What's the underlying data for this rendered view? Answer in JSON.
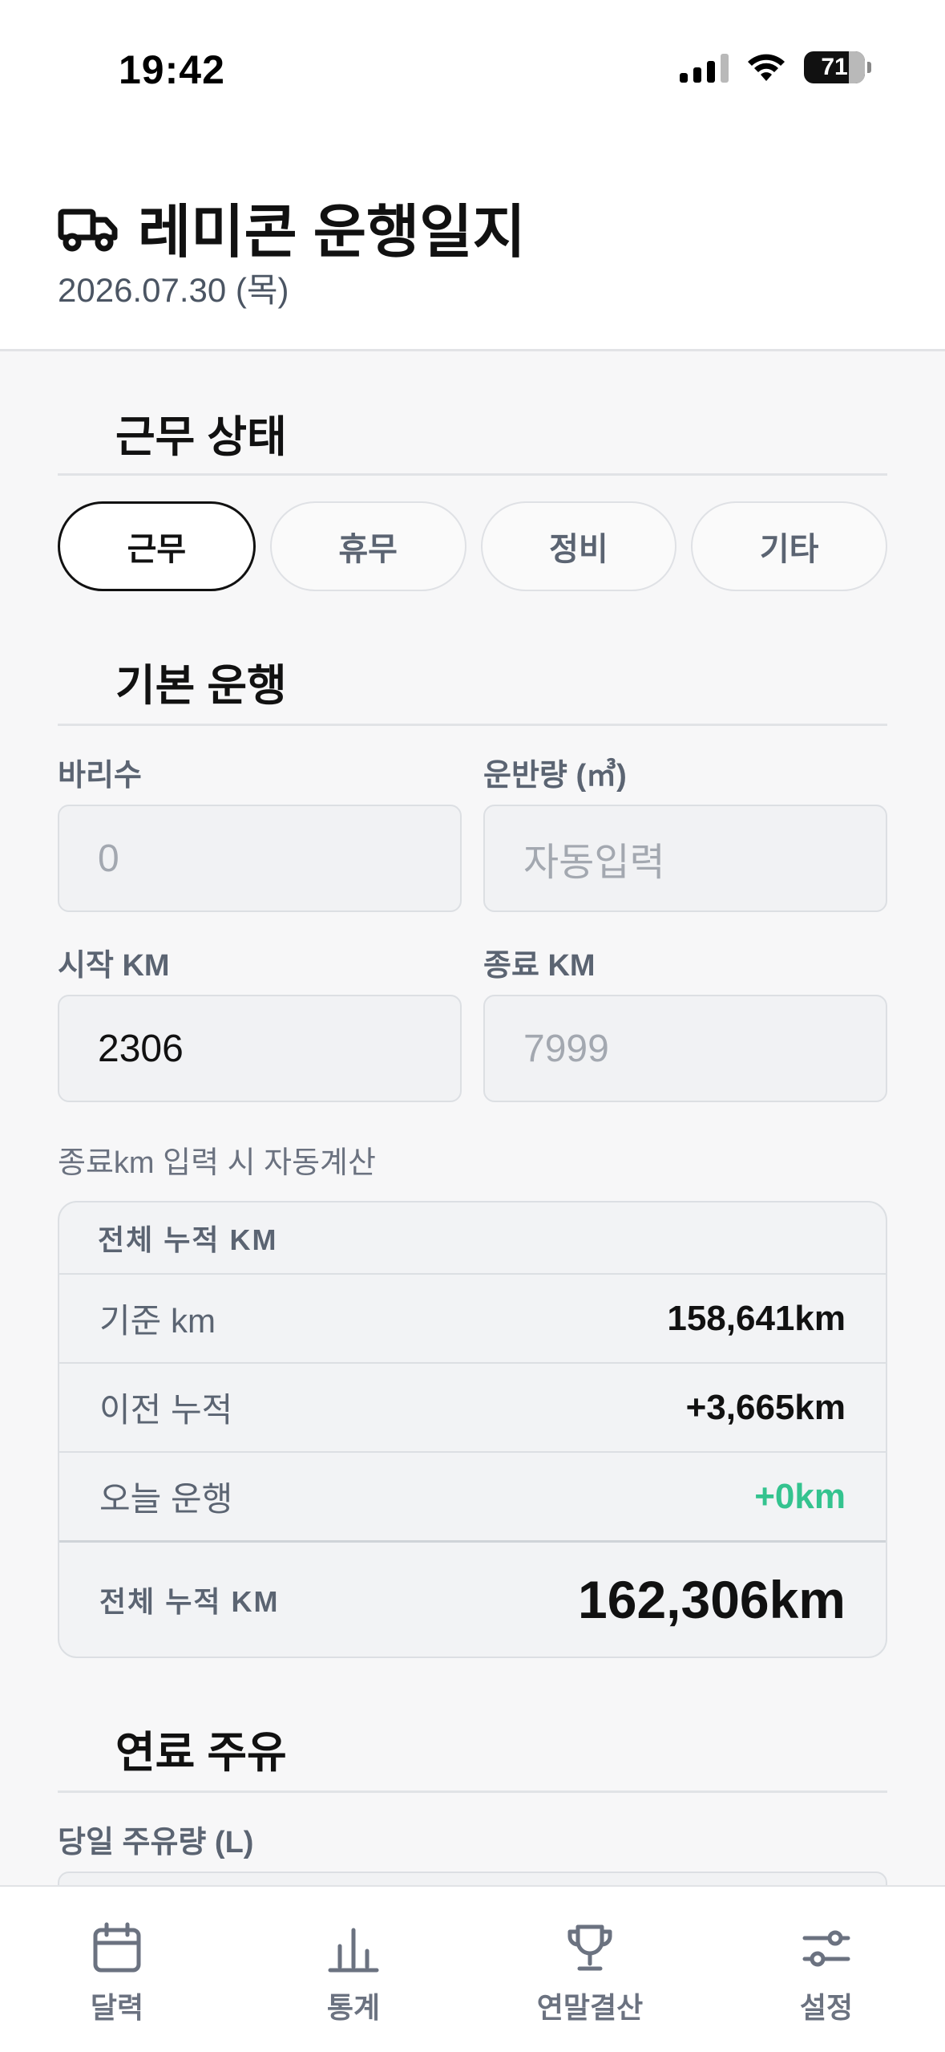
{
  "status_bar": {
    "time": "19:42",
    "battery": "71"
  },
  "header": {
    "icon": "truck-icon",
    "title": "레미콘 운행일지",
    "date": "2026.07.30 (목)"
  },
  "work_status": {
    "title": "근무 상태",
    "options": [
      "근무",
      "휴무",
      "정비",
      "기타"
    ],
    "selected": "근무"
  },
  "basic": {
    "title": "기본 운행",
    "trips_label": "바리수",
    "trips_placeholder": "0",
    "volume_label": "운반량 (㎥)",
    "volume_placeholder": "자동입력",
    "start_km_label": "시작 KM",
    "start_km_value": "2306",
    "end_km_label": "종료 KM",
    "end_km_placeholder": "7999",
    "hint": "종료km 입력 시 자동계산"
  },
  "summary": {
    "header": "전체 누적 KM",
    "rows": [
      {
        "label": "기준 km",
        "value": "158,641km"
      },
      {
        "label": "이전 누적",
        "value": "+3,665km"
      },
      {
        "label": "오늘 운행",
        "value": "+0km"
      }
    ],
    "total_label": "전체 누적 KM",
    "total_value": "162,306km",
    "accent_color": "#34c38f"
  },
  "fuel": {
    "title": "연료 주유",
    "daily_label": "당일 주유량 (L)"
  },
  "tabbar": {
    "items": [
      {
        "label": "달력",
        "icon": "calendar-icon"
      },
      {
        "label": "통계",
        "icon": "bar-chart-icon"
      },
      {
        "label": "연말결산",
        "icon": "trophy-icon"
      },
      {
        "label": "설정",
        "icon": "sliders-icon"
      }
    ]
  }
}
